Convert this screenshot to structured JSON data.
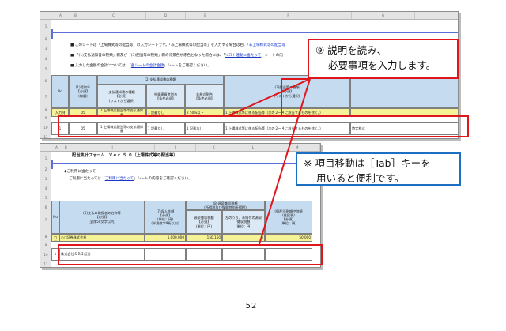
{
  "page_number": "52",
  "callout_input": {
    "line1": "⑨ 説明を読み、",
    "line2": "必要事項を入力します。"
  },
  "callout_tab": {
    "line1": "※ 項目移動は［Tab］キーを",
    "line2": "用いると便利です。"
  },
  "sheet1": {
    "col_letters": [
      "A",
      "B",
      "C",
      "D",
      "E",
      "F",
      "G",
      "H"
    ],
    "row_numbers": [
      "1",
      "2",
      "3",
      "4",
      "5",
      "6",
      "7",
      "8",
      "9",
      "10",
      "11"
    ],
    "note1_pre": "このシートは「上場株式等の配当等」の入力シートです。「非上場株式等の配当等」を入力する場合は右、「",
    "note1_link": "非上場株式等の配当等",
    "note2_pre": "「(1)支払通知書の種類」欄及び「(3)配当等の種類」欄の背景色が赤色となった場合には、「",
    "note2_link": "リスト連動に当たって",
    "note2_post": "」シートの内",
    "note3_pre": "入力した金額の合計については、「",
    "note3_link": "各シートの合計金額",
    "note3_post": "」シートをご確認ください。",
    "hdr_no": "No",
    "hdr_date": "(1)受取年",
    "hdr_required": "【必須】",
    "hdr_wareki": "(和暦)",
    "hdr_type_group": "(2)支払通知書の種類",
    "hdr_type": "支払通知書の種類",
    "hdr_type_req": "【必須】",
    "hdr_list": "(リストから選択)",
    "hdr_foreign": "外貨建資産割合",
    "hdr_foreign_req": "【条件必須】",
    "hdr_nontax": "非株式割合",
    "hdr_nontax_req": "【条件必須】",
    "hdr_kind_group": "(3)配当等の種類",
    "hdr_kind_req": "【必須】",
    "hdr_list2": "(リストから選択)",
    "ex_label": "入力例",
    "ex_year": "05",
    "ex_type": "1 上場株式配当等の支払通知書",
    "ex_foreign": "1 記載なし",
    "ex_nontax": "2 50%以下",
    "ex_kind": "1 上場株式等に係る配当等（次の２～４に該当するものを除く。）",
    "row1_no": "1",
    "row1_year": "05",
    "row1_type": "1 上場株式配当等の支払通知書",
    "row1_foreign": "1 記載なし",
    "row1_nontax": "1 記載なし",
    "row1_kind": "1 上場株式等に係る配当等（次の２～４に該当するものを除く。）",
    "row1_extra": "特定株式"
  },
  "sheet2": {
    "col_letters": [
      "A",
      "B",
      "I",
      "J",
      "K",
      "L",
      "M"
    ],
    "row_numbers": [
      "1",
      "2",
      "3",
      "4",
      "5",
      "6",
      "7",
      "8",
      "9",
      "10",
      "11"
    ],
    "title": "配当集計フォーム　Ｖｅｒ.５.０（上場株式等の配当等）",
    "note_head": "◆ご利用に当たって",
    "note_pre": "ご利用に当たっては「",
    "note_link": "ご利用に当たって",
    "note_post": "」シートの内容をご確認ください。",
    "hdr_no": "No",
    "hdr_payer": "(6)支払の取扱者の名称等",
    "hdr_payer_req": "【必須】",
    "hdr_payer_note": "(全角50文字以内)",
    "hdr_income": "(7)収入金額",
    "hdr_income_req": "【必須】",
    "hdr_unit": "(単位：円)",
    "hdr_digits": "(半角数字9桁以内)",
    "hdr_wh_group": "(8)源泉徴収税額",
    "hdr_wh_sub": "(所得税及び復興特別所得税)",
    "hdr_wh_amount": "源泉徴収税額",
    "hdr_wh_req": "【必須】",
    "hdr_wh_other": "左のうち、未納付の源泉徴収税額",
    "hdr_local_group": "(9)配当割額控除額",
    "hdr_local_sub": "(住民税)",
    "hdr_local_req": "【必須】",
    "ex_label": "入力例",
    "ex_payer": "○○証券株式会社",
    "ex_income": "1,000,000",
    "ex_wh": "150,150",
    "ex_wh_other": "0",
    "ex_local": "50,000",
    "row1_no": "1",
    "row1_payer": "株式会社ＳＢＩ証券"
  }
}
